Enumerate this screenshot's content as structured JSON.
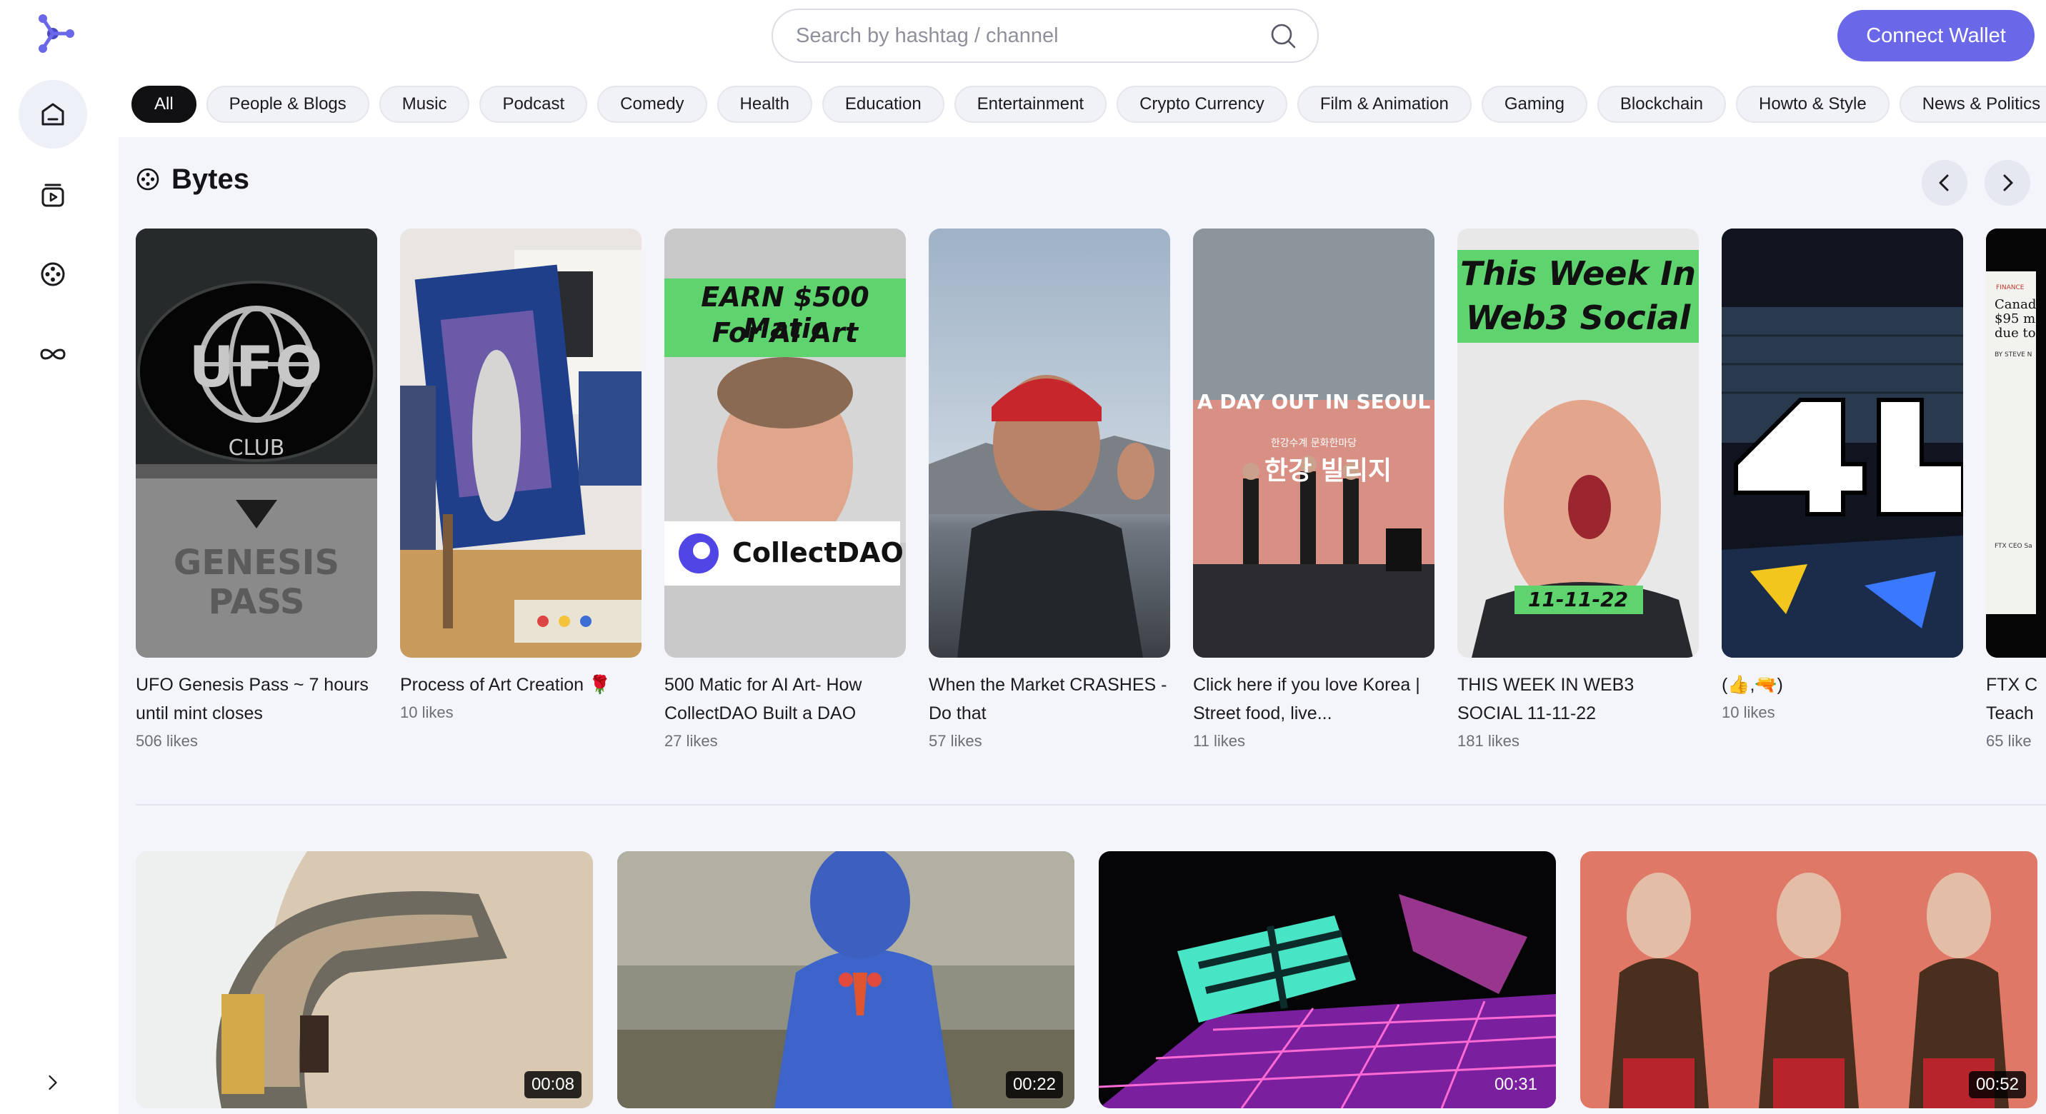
{
  "search": {
    "placeholder": "Search by hashtag / channel",
    "value": ""
  },
  "header": {
    "connect_label": "Connect Wallet"
  },
  "categories": [
    "All",
    "People & Blogs",
    "Music",
    "Podcast",
    "Comedy",
    "Health",
    "Education",
    "Entertainment",
    "Crypto Currency",
    "Film & Animation",
    "Gaming",
    "Blockchain",
    "Howto & Style",
    "News & Politics"
  ],
  "active_category": "All",
  "sidebar": {
    "items": [
      "home-icon",
      "subscriptions-icon",
      "bytes-icon",
      "loop-icon"
    ],
    "expand": "chevron-right-icon"
  },
  "bytes": {
    "title": "Bytes",
    "items": [
      {
        "title": "UFO Genesis Pass ~ 7 hours until mint closes",
        "likes": "506 likes",
        "thumb_text": [
          "UFO",
          "CLUB",
          "GENESIS",
          "PASS"
        ]
      },
      {
        "title": "Process of Art Creation 🌹",
        "likes": "10 likes"
      },
      {
        "title": "500 Matic for AI Art- How CollectDAO Built a DAO",
        "likes": "27 likes",
        "thumb_text": [
          "EARN $500 Matic",
          "For AI Art",
          "CollectDAO"
        ]
      },
      {
        "title": "When the Market CRASHES - Do that",
        "likes": "57 likes"
      },
      {
        "title": "Click here if you love Korea | Street food, live...",
        "likes": "11 likes",
        "thumb_text": [
          "A DAY OUT IN SEOUL",
          "한강수계 문화한마당",
          "한강 빌리지"
        ]
      },
      {
        "title": "THIS WEEK IN WEB3 SOCIAL 11-11-22",
        "likes": "181 likes",
        "thumb_text": [
          "This Week In",
          "Web3 Social",
          "11-11-22"
        ]
      },
      {
        "title": "(👍,🔫)",
        "likes": "10 likes"
      },
      {
        "title": "FTX C Teach",
        "likes": "65 like",
        "thumb_text": [
          "FINANCE",
          "Canad",
          "$95 m",
          "due to",
          "BY STEVE N",
          "FTX CEO Sa"
        ]
      }
    ]
  },
  "videos": [
    {
      "duration": "00:08"
    },
    {
      "duration": "00:22"
    },
    {
      "duration": "00:31"
    },
    {
      "duration": "00:52"
    }
  ],
  "colors": {
    "accent": "#6a67e8",
    "content_bg": "#f4f5fa",
    "chip_active": "#111114"
  }
}
